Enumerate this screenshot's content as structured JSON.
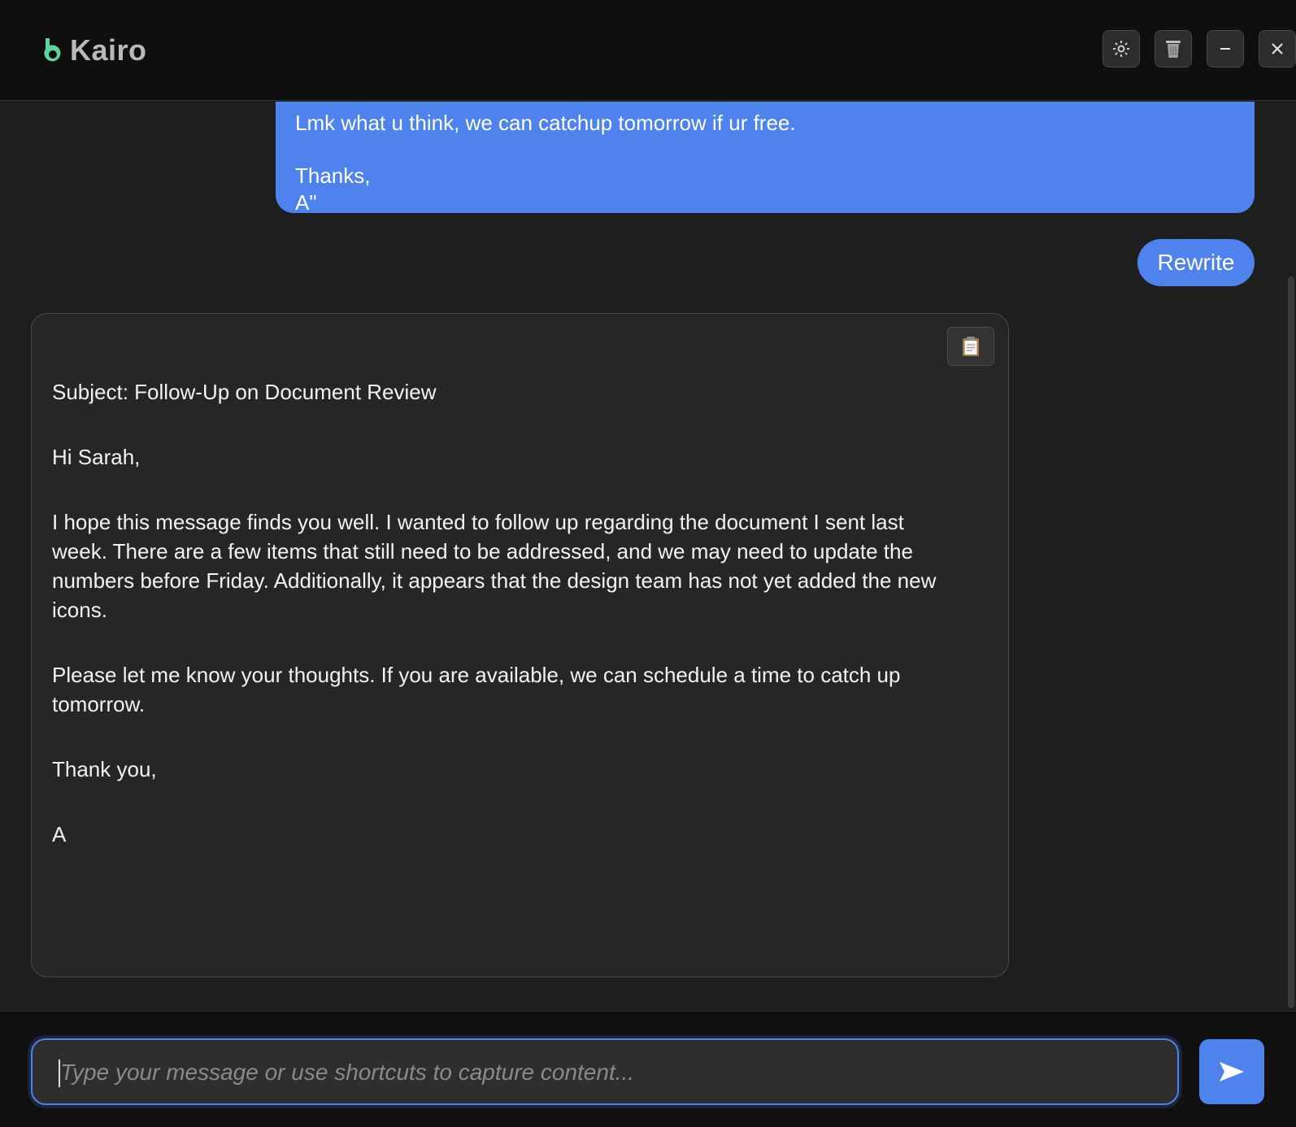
{
  "app": {
    "name": "Kairo",
    "accent_color": "#4e82ec",
    "logo_color": "#5dd39e"
  },
  "header": {
    "buttons": [
      {
        "icon": "gear-icon"
      },
      {
        "icon": "trash-icon"
      },
      {
        "icon": "minimize-icon"
      },
      {
        "icon": "close-icon"
      }
    ]
  },
  "conversation": {
    "user_message": {
      "lines": [
        "Lmk what u think, we can catchup tomorrow if ur free.",
        "Thanks,",
        "A\""
      ]
    },
    "action_button": {
      "label": "Rewrite"
    },
    "reply": {
      "copy_icon": "clipboard-icon",
      "paragraphs": [
        "Subject: Follow-Up on Document Review",
        "Hi Sarah,",
        "I hope this message finds you well. I wanted to follow up regarding the document I sent last week. There are a few items that still need to be addressed, and we may need to update the numbers before Friday. Additionally, it appears that the design team has not yet added the new icons.",
        "Please let me know your thoughts. If you are available, we can schedule a time to catch up tomorrow.",
        "Thank you,",
        "A"
      ]
    }
  },
  "composer": {
    "placeholder": "Type your message or use shortcuts to capture content...",
    "value": "",
    "send_icon": "send-icon"
  }
}
